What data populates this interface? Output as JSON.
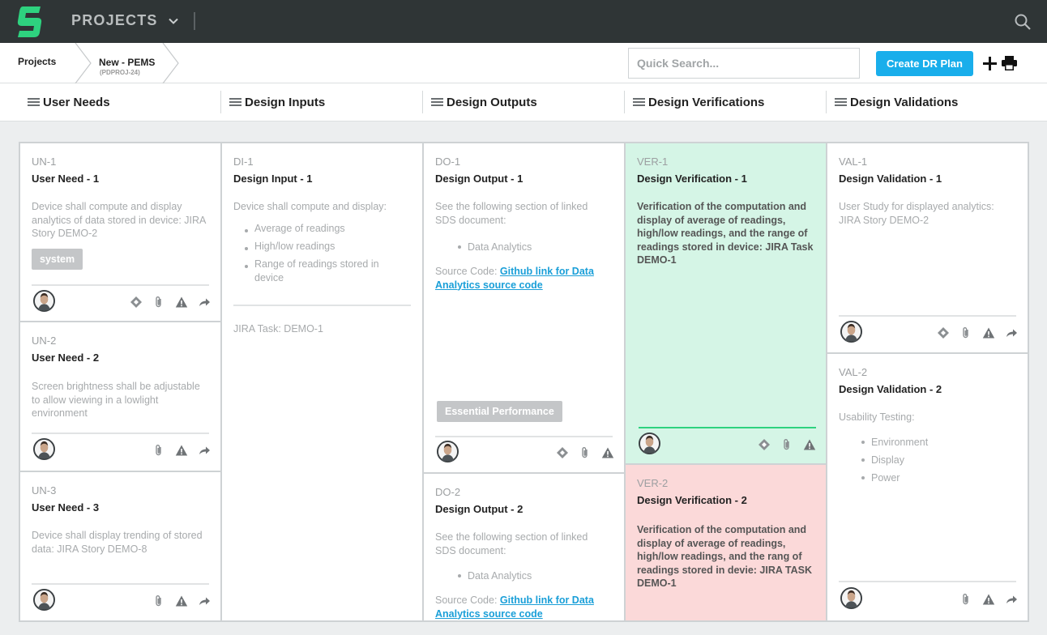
{
  "app": {
    "title": "PROJECTS"
  },
  "breadcrumb": {
    "root": "Projects",
    "current": "New - PEMS",
    "current_sub": "(PDPROJ-24)"
  },
  "toolbar": {
    "search_placeholder": "Quick Search...",
    "create_label": "Create DR Plan"
  },
  "columns": [
    {
      "label": "User Needs"
    },
    {
      "label": "Design Inputs"
    },
    {
      "label": "Design Outputs"
    },
    {
      "label": "Design Verifications"
    },
    {
      "label": "Design Validations"
    }
  ],
  "user_needs": [
    {
      "id": "UN-1",
      "title": "User Need - 1",
      "desc": "Device shall compute and display analytics of data stored in device: JIRA Story DEMO-2",
      "tag": "system"
    },
    {
      "id": "UN-2",
      "title": "User Need - 2",
      "desc": "Screen brightness shall be adjustable to allow viewing in a lowlight environment"
    },
    {
      "id": "UN-3",
      "title": "User Need - 3",
      "desc": "Device shall display trending of stored data: JIRA Story DEMO-8"
    }
  ],
  "design_inputs": [
    {
      "id": "DI-1",
      "title": "Design Input - 1",
      "desc": "Device shall compute and display:",
      "bullets": [
        "Average of readings",
        "High/low readings",
        "Range of readings stored in device"
      ],
      "footer": "JIRA Task: DEMO-1"
    }
  ],
  "design_outputs": [
    {
      "id": "DO-1",
      "title": "Design Output - 1",
      "desc": "See the following section of linked SDS document:",
      "bullets": [
        "Data Analytics"
      ],
      "source_label": "Source Code: ",
      "source_link": "Github link for Data Analytics source code",
      "tag": "Essential Performance"
    },
    {
      "id": "DO-2",
      "title": "Design Output - 2",
      "desc": "See the following section of linked SDS document:",
      "bullets": [
        "Data Analytics"
      ],
      "source_label": "Source Code: ",
      "source_link": "Github link for Data Analytics source code"
    }
  ],
  "design_verifications": [
    {
      "id": "VER-1",
      "title": "Design Verification - 1",
      "desc": "Verification of the computation and display of average of readings, high/low readings, and the range of readings stored in device: JIRA Task DEMO-1",
      "status": "pass",
      "status_color": "#d5f5e6"
    },
    {
      "id": "VER-2",
      "title": "Design Verification - 2",
      "desc": "Verification of the computation and display of average of readings, high/low readings, and the rang of readings stored in devie: JIRA TASK DEMO-1",
      "status": "fail",
      "status_color": "#fbd9d9"
    }
  ],
  "design_validations": [
    {
      "id": "VAL-1",
      "title": "Design Validation - 1",
      "desc": "User Study for displayed analytics: JIRA Story DEMO-2"
    },
    {
      "id": "VAL-2",
      "title": "Design Validation - 2",
      "desc": "Usability Testing:",
      "bullets": [
        "Environment",
        "Display",
        "Power"
      ]
    }
  ],
  "icons": {
    "logo": "logo-icon",
    "chevron": "chevron-down-icon",
    "search": "search-icon",
    "plus": "plus-icon",
    "print": "print-icon",
    "menu": "menu-icon",
    "avatar": "avatar",
    "diamond": "diamond-icon",
    "attach": "paperclip-icon",
    "warning": "warning-icon",
    "share": "share-icon"
  },
  "colors": {
    "topbar": "#2f3536",
    "brand_green": "#2ed27f",
    "accent_blue": "#19aeeb",
    "link": "#1a9fd8"
  }
}
